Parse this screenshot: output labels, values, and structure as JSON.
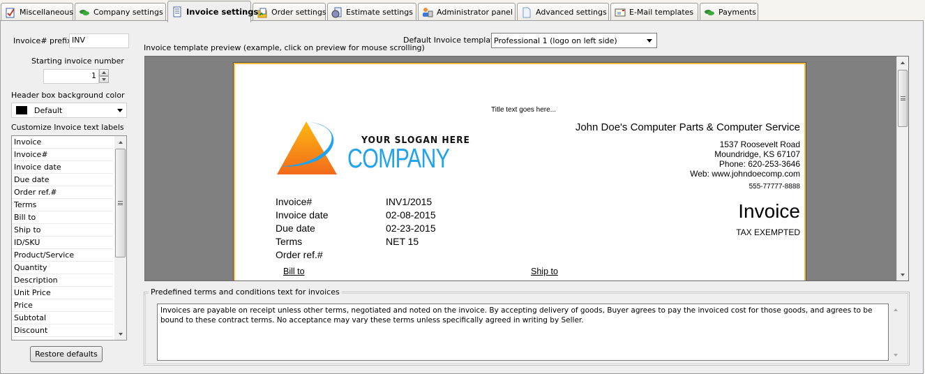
{
  "tabs": [
    {
      "label": "Miscellaneous",
      "icon": "checklist-icon",
      "active": false
    },
    {
      "label": "Company settings",
      "icon": "money-icon",
      "active": false
    },
    {
      "label": "Invoice settings",
      "icon": "invoice-document-icon",
      "active": true
    },
    {
      "label": "Order settings",
      "icon": "order-box-icon",
      "active": false
    },
    {
      "label": "Estimate settings",
      "icon": "estimate-icon",
      "active": false
    },
    {
      "label": "Administrator panel",
      "icon": "admin-users-icon",
      "active": false
    },
    {
      "label": "Advanced settings",
      "icon": "blank-page-icon",
      "active": false
    },
    {
      "label": "E-Mail templates",
      "icon": "email-template-icon",
      "active": false
    },
    {
      "label": "Payments",
      "icon": "money-icon",
      "active": false
    }
  ],
  "left": {
    "prefix_label": "Invoice# prefix",
    "prefix_value": "INV",
    "starting_number_label": "Starting invoice number",
    "starting_number_value": "1",
    "header_color_label": "Header box background color",
    "header_color_value": "Default",
    "header_color_swatch": "#000000",
    "labels_title": "Customize Invoice text labels",
    "text_labels": [
      "Invoice",
      "Invoice#",
      "Invoice date",
      "Due date",
      "Order ref.#",
      "Terms",
      "Bill to",
      "Ship to",
      "ID/SKU",
      "Product/Service",
      "Quantity",
      "Description",
      "Unit Price",
      "Price",
      "Subtotal",
      "Discount"
    ],
    "restore_button": "Restore defaults"
  },
  "preview": {
    "caption": "Invoice template preview (example, click on preview for mouse scrolling)",
    "template_label": "Default Invoice template",
    "template_value": "Professional 1 (logo on left side)",
    "invoice": {
      "title_text": "Title text goes here...",
      "logo_slogan": "YOUR SLOGAN HERE",
      "logo_company": "COMPANY",
      "company_name": "John Doe's Computer Parts & Computer Service",
      "address_lines": [
        "1537 Roosevelt Road",
        "Moundridge, KS 67107",
        "Phone: 620-253-3646",
        "Web: www.johndoecomp.com"
      ],
      "extra_line": "555-77777-8888",
      "fields": [
        {
          "label": "Invoice#",
          "value": "INV1/2015"
        },
        {
          "label": "Invoice date",
          "value": "02-08-2015"
        },
        {
          "label": "Due date",
          "value": "02-23-2015"
        },
        {
          "label": "Terms",
          "value": "NET 15"
        },
        {
          "label": "Order ref.#",
          "value": ""
        }
      ],
      "doc_title": "Invoice",
      "tax_status": "TAX EXEMPTED",
      "bill_to": "Bill to",
      "ship_to": "Ship to"
    }
  },
  "terms": {
    "group_title": "Predefined terms and conditions text for invoices",
    "text": "Invoices are payable on receipt unless other terms, negotiated and noted on the invoice. By accepting delivery of goods, Buyer agrees to pay the invoiced cost for those goods, and agrees to be bound to these contract terms. No acceptance may vary these terms unless specifically agreed in writing by Seller."
  },
  "colors": {
    "page_border": "#f6be3b",
    "logo_orange": "#f7931e",
    "logo_blue": "#1fa3ec"
  }
}
